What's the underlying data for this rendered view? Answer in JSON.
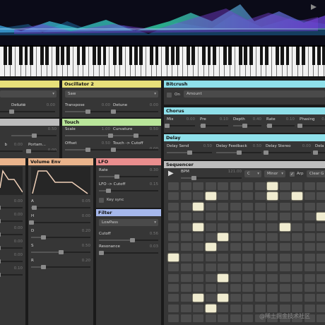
{
  "oscillator1": {
    "title": "",
    "wave": "",
    "knobs": [
      {
        "label": "",
        "value": "0.00",
        "level": 0.0
      },
      {
        "label": "Detune",
        "value": "0.00",
        "level": 0.0
      }
    ]
  },
  "oscillator2": {
    "title": "Oscillator 2",
    "wave": "Saw",
    "knobs": [
      {
        "label": "Transpose",
        "value": "0.00",
        "level": 0.5
      },
      {
        "label": "Detune",
        "value": "0.00",
        "level": 0.0
      }
    ]
  },
  "misc": {
    "title": "",
    "knobs": [
      {
        "label": "",
        "value": "0.50",
        "level": 0.5
      },
      {
        "label": "b",
        "value": "0.00",
        "level": 0.0
      },
      {
        "label": "Portam...",
        "value": "0.00",
        "level": 0.0
      }
    ]
  },
  "touch": {
    "title": "Touch",
    "knobs": [
      {
        "label": "Scale",
        "value": "1.00",
        "level": 1.0
      },
      {
        "label": "Curvature",
        "value": "0.50",
        "level": 0.5
      },
      {
        "label": "Offset",
        "value": "0.50",
        "level": 0.5
      },
      {
        "label": "Touch -> Cutoff",
        "value": "0.00",
        "level": 0.0
      }
    ]
  },
  "bitcrush": {
    "title": "Bitcrush",
    "on_label": "On",
    "amount_label": "Amount"
  },
  "chorus": {
    "title": "Chorus",
    "knobs": [
      {
        "label": "Mix",
        "value": "0.00",
        "level": 0.0
      },
      {
        "label": "Pre",
        "value": "0.10",
        "level": 0.1
      },
      {
        "label": "Depth",
        "value": "0.40",
        "level": 0.4
      },
      {
        "label": "Rate",
        "value": "0.10",
        "level": 0.1
      },
      {
        "label": "Phasing",
        "value": "0.0",
        "level": 0.0
      }
    ]
  },
  "delay": {
    "title": "Delay",
    "knobs": [
      {
        "label": "Delay Send",
        "value": "0.50",
        "level": 0.5
      },
      {
        "label": "Delay Feedback",
        "value": "0.50",
        "level": 0.5
      },
      {
        "label": "Delay Stereo",
        "value": "0.00",
        "level": 0.0
      },
      {
        "label": "Dela",
        "value": "",
        "level": 0.0
      }
    ]
  },
  "envelope1": {
    "title": "",
    "values": [
      "0.00",
      "0.00",
      "0.00",
      "0.00",
      "0.00",
      "0.10"
    ]
  },
  "volume_env": {
    "title": "Volume Env",
    "knobs": [
      {
        "label": "A",
        "value": "0.05",
        "level": 0.05
      },
      {
        "label": "H",
        "value": "0.00",
        "level": 0.0
      },
      {
        "label": "D",
        "value": "0.20",
        "level": 0.2
      },
      {
        "label": "S",
        "value": "0.50",
        "level": 0.5
      },
      {
        "label": "R",
        "value": "0.20",
        "level": 0.2
      }
    ]
  },
  "lfo": {
    "title": "LFO",
    "keysync_label": "Key sync",
    "knobs": [
      {
        "label": "Rate",
        "value": "0.30",
        "level": 0.3
      },
      {
        "label": "LFO -> Cutoff",
        "value": "0.15",
        "level": 0.15
      }
    ]
  },
  "filter": {
    "title": "Filter",
    "type": "LowPass",
    "knobs": [
      {
        "label": "Cutoff",
        "value": "0.56",
        "level": 0.56
      },
      {
        "label": "Resonance",
        "value": "0.03",
        "level": 0.03
      }
    ]
  },
  "sequencer": {
    "title": "Sequencer",
    "bpm_label": "BPM",
    "bpm_value": "121.00",
    "key": "C",
    "scale": "Minor",
    "arp_label": "Arp",
    "clear_label": "Clear G",
    "play_icon": "play-icon",
    "grid": [
      [
        0,
        0,
        0,
        0,
        0,
        0,
        0,
        0,
        1,
        0,
        0,
        0,
        0,
        0,
        0
      ],
      [
        0,
        0,
        0,
        1,
        0,
        0,
        0,
        0,
        1,
        0,
        1,
        0,
        0,
        0,
        0
      ],
      [
        0,
        0,
        1,
        0,
        0,
        0,
        0,
        0,
        0,
        0,
        0,
        0,
        0,
        0,
        0
      ],
      [
        0,
        0,
        0,
        0,
        0,
        0,
        0,
        0,
        0,
        0,
        0,
        0,
        1,
        0,
        0
      ],
      [
        0,
        0,
        1,
        0,
        0,
        0,
        0,
        0,
        0,
        1,
        0,
        0,
        0,
        0,
        0
      ],
      [
        0,
        0,
        0,
        0,
        1,
        0,
        0,
        0,
        0,
        0,
        0,
        0,
        0,
        0,
        0
      ],
      [
        0,
        0,
        0,
        1,
        0,
        0,
        0,
        0,
        0,
        0,
        0,
        0,
        0,
        0,
        0
      ],
      [
        1,
        0,
        0,
        0,
        0,
        0,
        0,
        0,
        0,
        0,
        0,
        0,
        0,
        0,
        0
      ],
      [
        0,
        0,
        0,
        0,
        0,
        0,
        0,
        0,
        0,
        0,
        0,
        0,
        0,
        0,
        0
      ],
      [
        0,
        0,
        0,
        0,
        1,
        0,
        0,
        0,
        0,
        0,
        0,
        0,
        0,
        0,
        0
      ],
      [
        0,
        0,
        0,
        0,
        0,
        0,
        0,
        0,
        0,
        0,
        0,
        0,
        0,
        0,
        0
      ],
      [
        0,
        0,
        1,
        0,
        1,
        0,
        0,
        0,
        0,
        0,
        0,
        0,
        0,
        0,
        0
      ],
      [
        0,
        0,
        0,
        1,
        0,
        0,
        0,
        0,
        0,
        0,
        0,
        0,
        0,
        0,
        0
      ],
      [
        0,
        0,
        0,
        0,
        0,
        0,
        0,
        0,
        0,
        0,
        0,
        0,
        0,
        0,
        0
      ]
    ]
  },
  "watermark": "@稀土掘金技术社区",
  "colors": {
    "osc": "#e7e07a",
    "touch": "#b9e59a",
    "fx": "#8fe0ea",
    "env": "#eab48c",
    "lfo": "#ea8e8e",
    "filter": "#a6b8ec",
    "lit_step": "#f0ecd0"
  }
}
